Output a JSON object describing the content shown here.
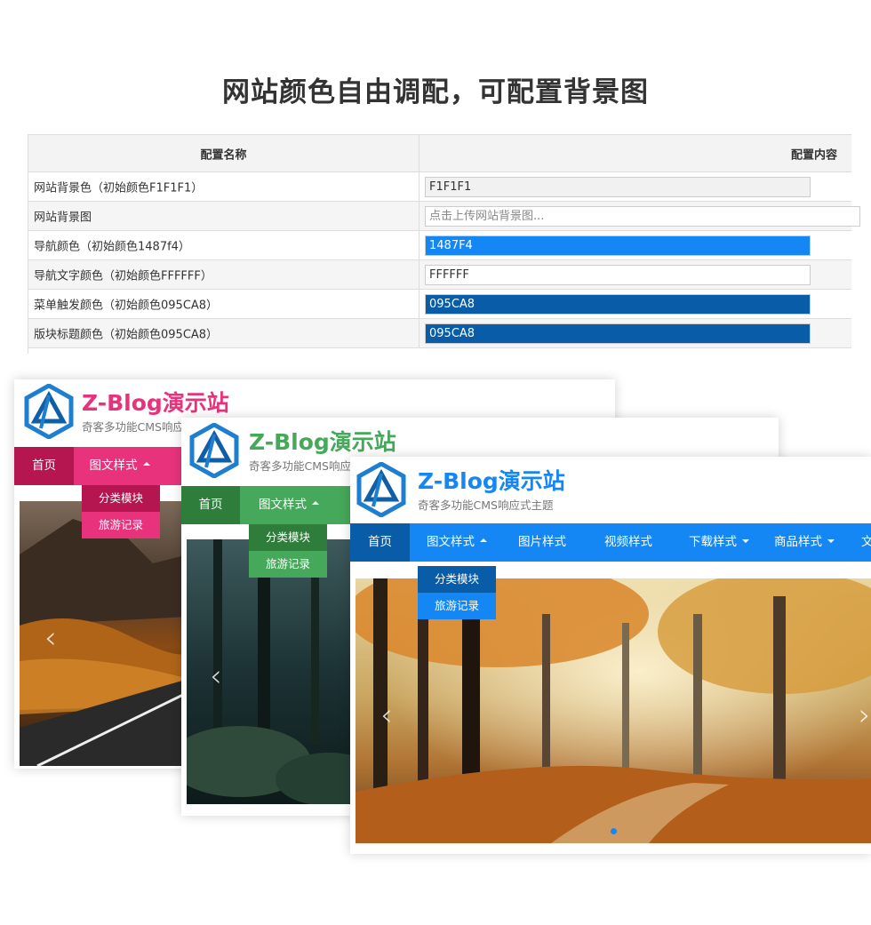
{
  "headline": "网站颜色自由调配，可配置背景图",
  "config_table": {
    "col_name": "配置名称",
    "col_value": "配置内容",
    "rows": [
      {
        "label": "网站背景色（初始颜色F1F1F1）",
        "value": "F1F1F1",
        "bg": "#F1F1F1",
        "fg": "#333333"
      },
      {
        "label": "网站背景图",
        "placeholder": "点击上传网站背景图..."
      },
      {
        "label": "导航颜色（初始颜色1487f4）",
        "value": "1487F4",
        "bg": "#1487F4",
        "fg": "#FFFFFF"
      },
      {
        "label": "导航文字颜色（初始颜色FFFFFF）",
        "value": "FFFFFF",
        "bg": "#FFFFFF",
        "fg": "#333333"
      },
      {
        "label": "菜单触发颜色（初始颜色095CA8）",
        "value": "095CA8",
        "bg": "#095CA8",
        "fg": "#FFFFFF"
      },
      {
        "label": "版块标题颜色（初始颜色095CA8）",
        "value": "095CA8",
        "bg": "#095CA8",
        "fg": "#FFFFFF"
      }
    ]
  },
  "demos": [
    {
      "title": "Z-Blog演示站",
      "subtitle": "奇客多功能CMS响应",
      "accent": "#E8337C",
      "accent_dark": "#B5164F",
      "nav_active_text_color": "#FFFFFF",
      "nav": [
        {
          "label": "首页"
        },
        {
          "label": "图文样式",
          "caret": "up"
        }
      ],
      "dropdown": [
        "分类模块",
        "旅游记录"
      ]
    },
    {
      "title": "Z-Blog演示站",
      "subtitle": "奇客多功能CMS响应",
      "accent": "#46A85A",
      "accent_dark": "#2E7D3A",
      "nav": [
        {
          "label": "首页"
        },
        {
          "label": "图文样式",
          "caret": "up"
        }
      ],
      "dropdown": [
        "分类模块",
        "旅游记录"
      ]
    },
    {
      "title": "Z-Blog演示站",
      "subtitle": "奇客多功能CMS响应式主题",
      "accent": "#1487F4",
      "accent_dark": "#095CA8",
      "nav": [
        {
          "label": "首页"
        },
        {
          "label": "图文样式",
          "caret": "up"
        },
        {
          "label": "图片样式"
        },
        {
          "label": "视频样式"
        },
        {
          "label": "下载样式",
          "caret": "down"
        },
        {
          "label": "商品样式",
          "caret": "down"
        },
        {
          "label": "文"
        }
      ],
      "dropdown": [
        "分类模块",
        "旅游记录"
      ]
    }
  ]
}
